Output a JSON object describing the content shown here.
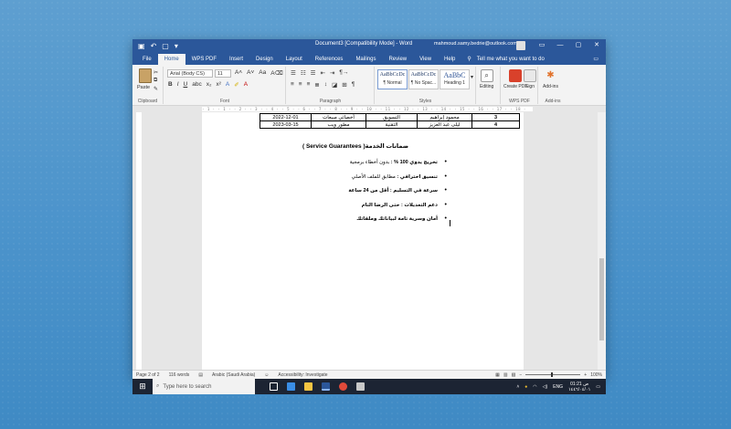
{
  "window": {
    "title": "Document3 [Compatibility Mode] - Word",
    "user_email": "mahmoud.samy.bedrie@outlook.com"
  },
  "tabs": [
    "File",
    "Home",
    "WPS PDF",
    "Insert",
    "Design",
    "Layout",
    "References",
    "Mailings",
    "Review",
    "View",
    "Help"
  ],
  "tell_me": "Tell me what you want to do",
  "ribbon": {
    "paste_label": "Paste",
    "clipboard_label": "Clipboard",
    "font_name": "Arial (Body CS)",
    "font_size": "11",
    "font_label": "Font",
    "paragraph_label": "Paragraph",
    "styles": [
      {
        "sample": "AaBbCcDc",
        "name": "¶ Normal"
      },
      {
        "sample": "AaBbCcDc",
        "name": "¶ No Spac..."
      },
      {
        "sample": "AaBbC",
        "name": "Heading 1"
      }
    ],
    "styles_label": "Styles",
    "editing_label": "Editing",
    "create_pdf_label": "Create PDF",
    "sign_label": "Sign",
    "wps_pdf_label": "WPS PDF",
    "addins_label": "Add-ins",
    "addins_group_label": "Add-ins"
  },
  "table_rows": [
    {
      "date": "2022-12-01",
      "role": "أخصائي مبيعات",
      "field": "التسويق",
      "name": "محمود إبراهيم",
      "num": "3"
    },
    {
      "date": "2023-03-15",
      "role": "مطور ويب",
      "field": "التقنية",
      "name": "ليلى عبد العزيز",
      "num": "4"
    }
  ],
  "heading": "ضمانات الخدمة( Service Guarantees )",
  "bullets": [
    {
      "bold": "تخريج يدوي 100 % :",
      "text": " بدون أخطاء برمجية"
    },
    {
      "bold": "تنسيق احترافي :",
      "text": " مطابق للملف الأصلي"
    },
    {
      "bold": "سرعة في التسليم : أقل من 24 ساعة",
      "text": ""
    },
    {
      "bold": "دعم التعديلات : حتى الرضا التام",
      "text": ""
    },
    {
      "bold": "أمان وسرية تامة لبياناتك وملفاتك",
      "text": ""
    }
  ],
  "status": {
    "page": "Page 2 of 2",
    "words": "116 words",
    "language": "Arabic (Saudi Arabia)",
    "accessibility": "Accessibility: Investigate",
    "zoom": "100%"
  },
  "taskbar": {
    "search_placeholder": "Type here to search",
    "lang": "ENG",
    "time": "01:21 ص",
    "date": "١٤٤٦/٠٤/٠١"
  },
  "colors": {
    "word_blue": "#2b579a",
    "taskbar": "#1c2433"
  }
}
